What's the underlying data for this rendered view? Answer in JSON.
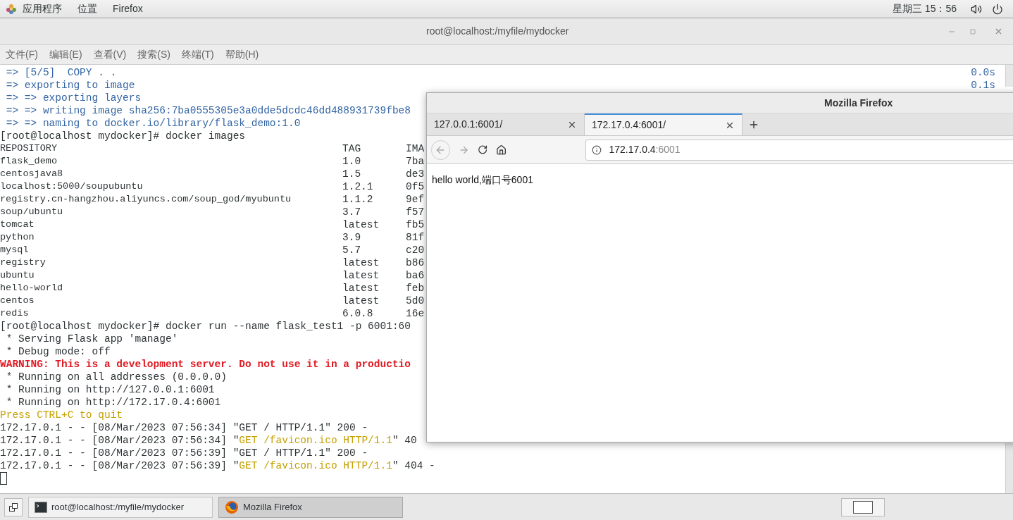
{
  "top_bar": {
    "menus": [
      "应用程序",
      "位置",
      "Firefox"
    ],
    "clock": "星期三 15：56"
  },
  "terminal": {
    "title": "root@localhost:/myfile/mydocker",
    "menu": [
      "文件(F)",
      "编辑(E)",
      "查看(V)",
      "搜索(S)",
      "终端(T)",
      "帮助(H)"
    ],
    "lines": [
      {
        "kind": "output",
        "segments": [
          {
            "text": " => [5/5]  COPY . .",
            "color": "#3465a4"
          }
        ],
        "time": "0.0s"
      },
      {
        "kind": "output",
        "segments": [
          {
            "text": " => exporting to image",
            "color": "#3465a4"
          }
        ],
        "time": "0.1s"
      },
      {
        "kind": "output",
        "segments": [
          {
            "text": " => => exporting layers",
            "color": "#3465a4"
          }
        ]
      },
      {
        "kind": "output",
        "segments": [
          {
            "text": " => => writing image sha256:7ba0555305e3a0dde5dcdc46dd488931739fbe8",
            "color": "#3465a4"
          }
        ]
      },
      {
        "kind": "output",
        "segments": [
          {
            "text": " => => naming to docker.io/library/flask_demo:1.0",
            "color": "#3465a4"
          }
        ]
      },
      {
        "kind": "output",
        "segments": [
          {
            "text": "[root@localhost mydocker]# docker images",
            "color": "#2e3436"
          }
        ]
      },
      {
        "kind": "image-row",
        "cells": [
          "REPOSITORY",
          "TAG",
          "IMA"
        ]
      },
      {
        "kind": "image-row",
        "cells": [
          "flask_demo",
          "1.0",
          "7ba"
        ]
      },
      {
        "kind": "image-row",
        "cells": [
          "centosjava8",
          "1.5",
          "de3"
        ]
      },
      {
        "kind": "image-row",
        "cells": [
          "localhost:5000/soupubuntu",
          "1.2.1",
          "0f5"
        ]
      },
      {
        "kind": "image-row",
        "cells": [
          "registry.cn-hangzhou.aliyuncs.com/soup_god/myubuntu",
          "1.1.2",
          "9ef"
        ]
      },
      {
        "kind": "image-row",
        "cells": [
          "soup/ubuntu",
          "3.7",
          "f57"
        ]
      },
      {
        "kind": "image-row",
        "cells": [
          "tomcat",
          "latest",
          "fb5"
        ]
      },
      {
        "kind": "image-row",
        "cells": [
          "python",
          "3.9",
          "81f"
        ]
      },
      {
        "kind": "image-row",
        "cells": [
          "mysql",
          "5.7",
          "c20"
        ]
      },
      {
        "kind": "image-row",
        "cells": [
          "registry",
          "latest",
          "b86"
        ]
      },
      {
        "kind": "image-row",
        "cells": [
          "ubuntu",
          "latest",
          "ba6"
        ]
      },
      {
        "kind": "image-row",
        "cells": [
          "hello-world",
          "latest",
          "feb"
        ]
      },
      {
        "kind": "image-row",
        "cells": [
          "centos",
          "latest",
          "5d0"
        ]
      },
      {
        "kind": "image-row",
        "cells": [
          "redis",
          "6.0.8",
          "16e"
        ]
      },
      {
        "kind": "output",
        "segments": [
          {
            "text": "[root@localhost mydocker]# docker run --name flask_test1 -p 6001:60",
            "color": "#2e3436"
          }
        ]
      },
      {
        "kind": "output",
        "segments": [
          {
            "text": " * Serving Flask app 'manage'",
            "color": "#2e3436"
          }
        ]
      },
      {
        "kind": "output",
        "segments": [
          {
            "text": " * Debug mode: off",
            "color": "#2e3436"
          }
        ]
      },
      {
        "kind": "output",
        "segments": [
          {
            "text": "WARNING: This is a development server. Do not use it in a productio",
            "color": "#e01b24",
            "bold": true
          }
        ]
      },
      {
        "kind": "output",
        "segments": [
          {
            "text": " * Running on all addresses (0.0.0.0)",
            "color": "#2e3436"
          }
        ]
      },
      {
        "kind": "output",
        "segments": [
          {
            "text": " * Running on http://127.0.0.1:6001",
            "color": "#2e3436"
          }
        ]
      },
      {
        "kind": "output",
        "segments": [
          {
            "text": " * Running on http://172.17.0.4:6001",
            "color": "#2e3436"
          }
        ]
      },
      {
        "kind": "output",
        "segments": [
          {
            "text": "Press CTRL+C to quit",
            "color": "#c4a000"
          }
        ]
      },
      {
        "kind": "output",
        "segments": [
          {
            "text": "172.17.0.1 - - [08/Mar/2023 07:56:34] \"GET / HTTP/1.1\" 200 -",
            "color": "#2e3436"
          }
        ]
      },
      {
        "kind": "output",
        "segments": [
          {
            "text": "172.17.0.1 - - [08/Mar/2023 07:56:34] \"",
            "color": "#2e3436"
          },
          {
            "text": "GET /favicon.ico HTTP/1.1",
            "color": "#c4a000"
          },
          {
            "text": "\" 40",
            "color": "#2e3436"
          }
        ]
      },
      {
        "kind": "output",
        "segments": [
          {
            "text": "172.17.0.1 - - [08/Mar/2023 07:56:39] \"GET / HTTP/1.1\" 200 -",
            "color": "#2e3436"
          }
        ]
      },
      {
        "kind": "output",
        "segments": [
          {
            "text": "172.17.0.1 - - [08/Mar/2023 07:56:39] \"",
            "color": "#2e3436"
          },
          {
            "text": "GET /favicon.ico HTTP/1.1",
            "color": "#c4a000"
          },
          {
            "text": "\" 404 -",
            "color": "#2e3436"
          }
        ]
      },
      {
        "kind": "cursor"
      }
    ]
  },
  "firefox": {
    "title": "Mozilla Firefox",
    "tabs": [
      {
        "label": "127.0.0.1:6001/",
        "selected": false
      },
      {
        "label": "172.17.0.4:6001/",
        "selected": true
      }
    ],
    "url": {
      "host": "172.17.0.4",
      "port": ":6001"
    },
    "content": "hello world,端口号6001"
  },
  "taskbar": {
    "tasks": [
      {
        "label": "root@localhost:/myfile/mydocker",
        "kind": "terminal",
        "selected": false
      },
      {
        "label": "Mozilla Firefox",
        "kind": "firefox",
        "selected": true
      }
    ]
  }
}
